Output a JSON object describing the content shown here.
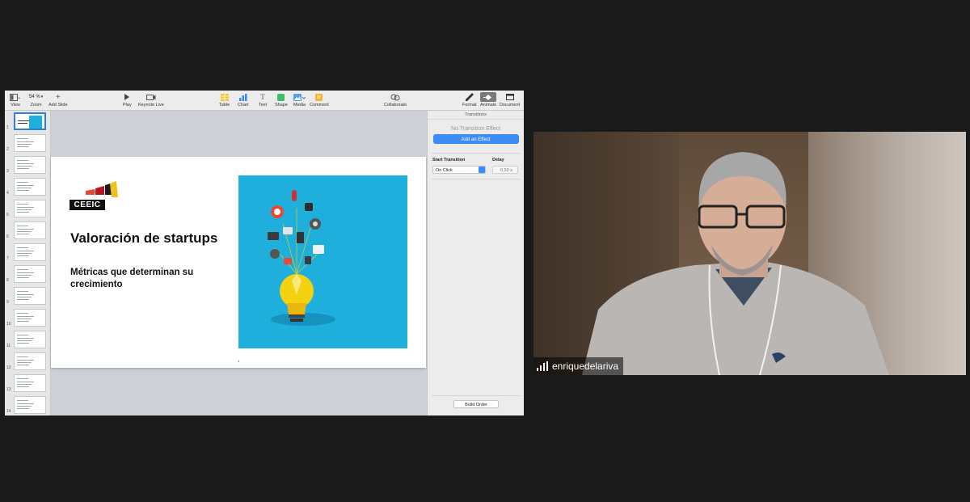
{
  "toolbar": {
    "view": "View",
    "zoom_value": "54 %",
    "zoom": "Zoom",
    "add_slide": "Add Slide",
    "play": "Play",
    "keynote_live": "Keynote Live",
    "table": "Table",
    "chart": "Chart",
    "text": "Text",
    "shape": "Shape",
    "media": "Media",
    "comment": "Comment",
    "collaborate": "Collaborate",
    "format": "Format",
    "animate": "Animate",
    "document": "Document"
  },
  "navigator": {
    "slide_numbers": [
      "1",
      "2",
      "3",
      "4",
      "5",
      "6",
      "7",
      "8",
      "9",
      "10",
      "11",
      "12",
      "13",
      "14"
    ],
    "selected": "1"
  },
  "slide": {
    "logo_text": "CEEIC",
    "title": "Valoración de startups",
    "subtitle": "Métricas que determinan su crecimiento",
    "page_number": "1"
  },
  "inspector": {
    "tab_title": "Transitions",
    "no_transition": "No Transition Effect",
    "add_effect": "Add an Effect",
    "start_transition_label": "Start Transition",
    "start_transition_value": "On Click",
    "delay_label": "Delay",
    "delay_value": "0,50 s",
    "build_order": "Build Order"
  },
  "video": {
    "participant_name": "enriquedelariva"
  },
  "colors": {
    "accent": "#3b8cf6",
    "slide_image_bg": "#1fafdc",
    "background": "#1a1a1a"
  }
}
